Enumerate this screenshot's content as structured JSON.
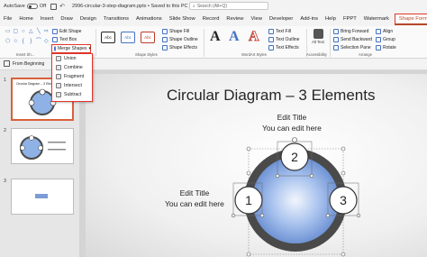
{
  "titlebar": {
    "autosave_label": "AutoSave",
    "autosave_state": "Off",
    "doc_name": "2996-circular-3-step-diagram.pptx • Saved to this PC",
    "search_placeholder": "Search (Alt+Q)"
  },
  "menu": {
    "tabs": [
      "File",
      "Home",
      "Insert",
      "Draw",
      "Design",
      "Transitions",
      "Animations",
      "Slide Show",
      "Record",
      "Review",
      "View",
      "Developer",
      "Add-ins",
      "Help",
      "FPPT",
      "Watermark"
    ],
    "active_tab": "Shape Format"
  },
  "ribbon": {
    "edit_shape": "Edit Shape",
    "text_box": "Text Box",
    "merge_shapes": "Merge Shapes",
    "swatches": [
      "Abc",
      "Abc",
      "Abc"
    ],
    "shape_fill": "Shape Fill",
    "shape_outline": "Shape Outline",
    "shape_effects": "Shape Effects",
    "text_fill": "Text Fill",
    "text_outline": "Text Outline",
    "text_effects": "Text Effects",
    "alt_text": "Alt Text",
    "bring_forward": "Bring Forward",
    "send_backward": "Send Backward",
    "selection_pane": "Selection Pane",
    "align": "Align",
    "group": "Group",
    "rotate": "Rotate",
    "groups": {
      "insert_shapes": "Insert Sh...",
      "shape_styles": "Shape Styles",
      "wordart_styles": "WordArt Styles",
      "accessibility": "Accessibility",
      "arrange": "Arrange"
    }
  },
  "merge_menu": [
    "Union",
    "Combine",
    "Fragment",
    "Intersect",
    "Subtract"
  ],
  "quickbar": {
    "from_beginning": "From Beginning"
  },
  "thumbnails": [
    {
      "num": "1",
      "title": "Circular Diagram – 3 Elements",
      "selected": true
    },
    {
      "num": "2",
      "title": "",
      "selected": false
    },
    {
      "num": "3",
      "title": "",
      "selected": false
    }
  ],
  "slide": {
    "title": "Circular Diagram – 3 Elements",
    "top_label": {
      "title": "Edit Title",
      "body": "You can edit here"
    },
    "left_label": {
      "title": "Edit Title",
      "body": "You can edit here"
    },
    "numbers": [
      "1",
      "2",
      "3"
    ]
  },
  "colors": {
    "accent_red": "#e0362b",
    "ring": "#4a4a4a",
    "blue_center": "#8fb2e6"
  }
}
